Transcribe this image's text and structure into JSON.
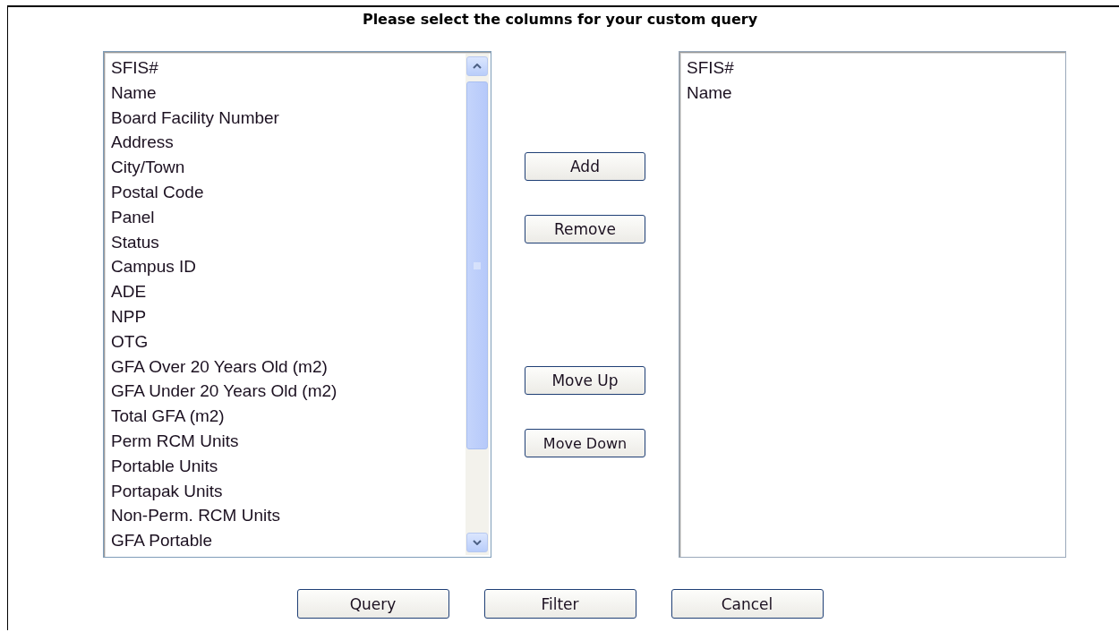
{
  "title": "Please select the columns for your custom query",
  "available_columns": [
    "SFIS#",
    "Name",
    "Board Facility Number",
    "Address",
    "City/Town",
    "Postal Code",
    "Panel",
    "Status",
    "Campus ID",
    "ADE",
    "NPP",
    "OTG",
    "GFA Over 20 Years Old (m2)",
    "GFA Under 20 Years Old (m2)",
    "Total GFA (m2)",
    "Perm RCM Units",
    "Portable Units",
    "Portapak Units",
    "Non-Perm. RCM Units",
    "GFA Portable"
  ],
  "selected_columns": [
    "SFIS#",
    "Name"
  ],
  "side_buttons": [
    {
      "label": "Add",
      "kind": "add"
    },
    {
      "label": "Remove",
      "kind": "remove"
    },
    {
      "label": "Move Up",
      "kind": "up"
    },
    {
      "label": "Move Down",
      "kind": "down"
    }
  ],
  "action_buttons": [
    "Query",
    "Filter",
    "Cancel"
  ]
}
